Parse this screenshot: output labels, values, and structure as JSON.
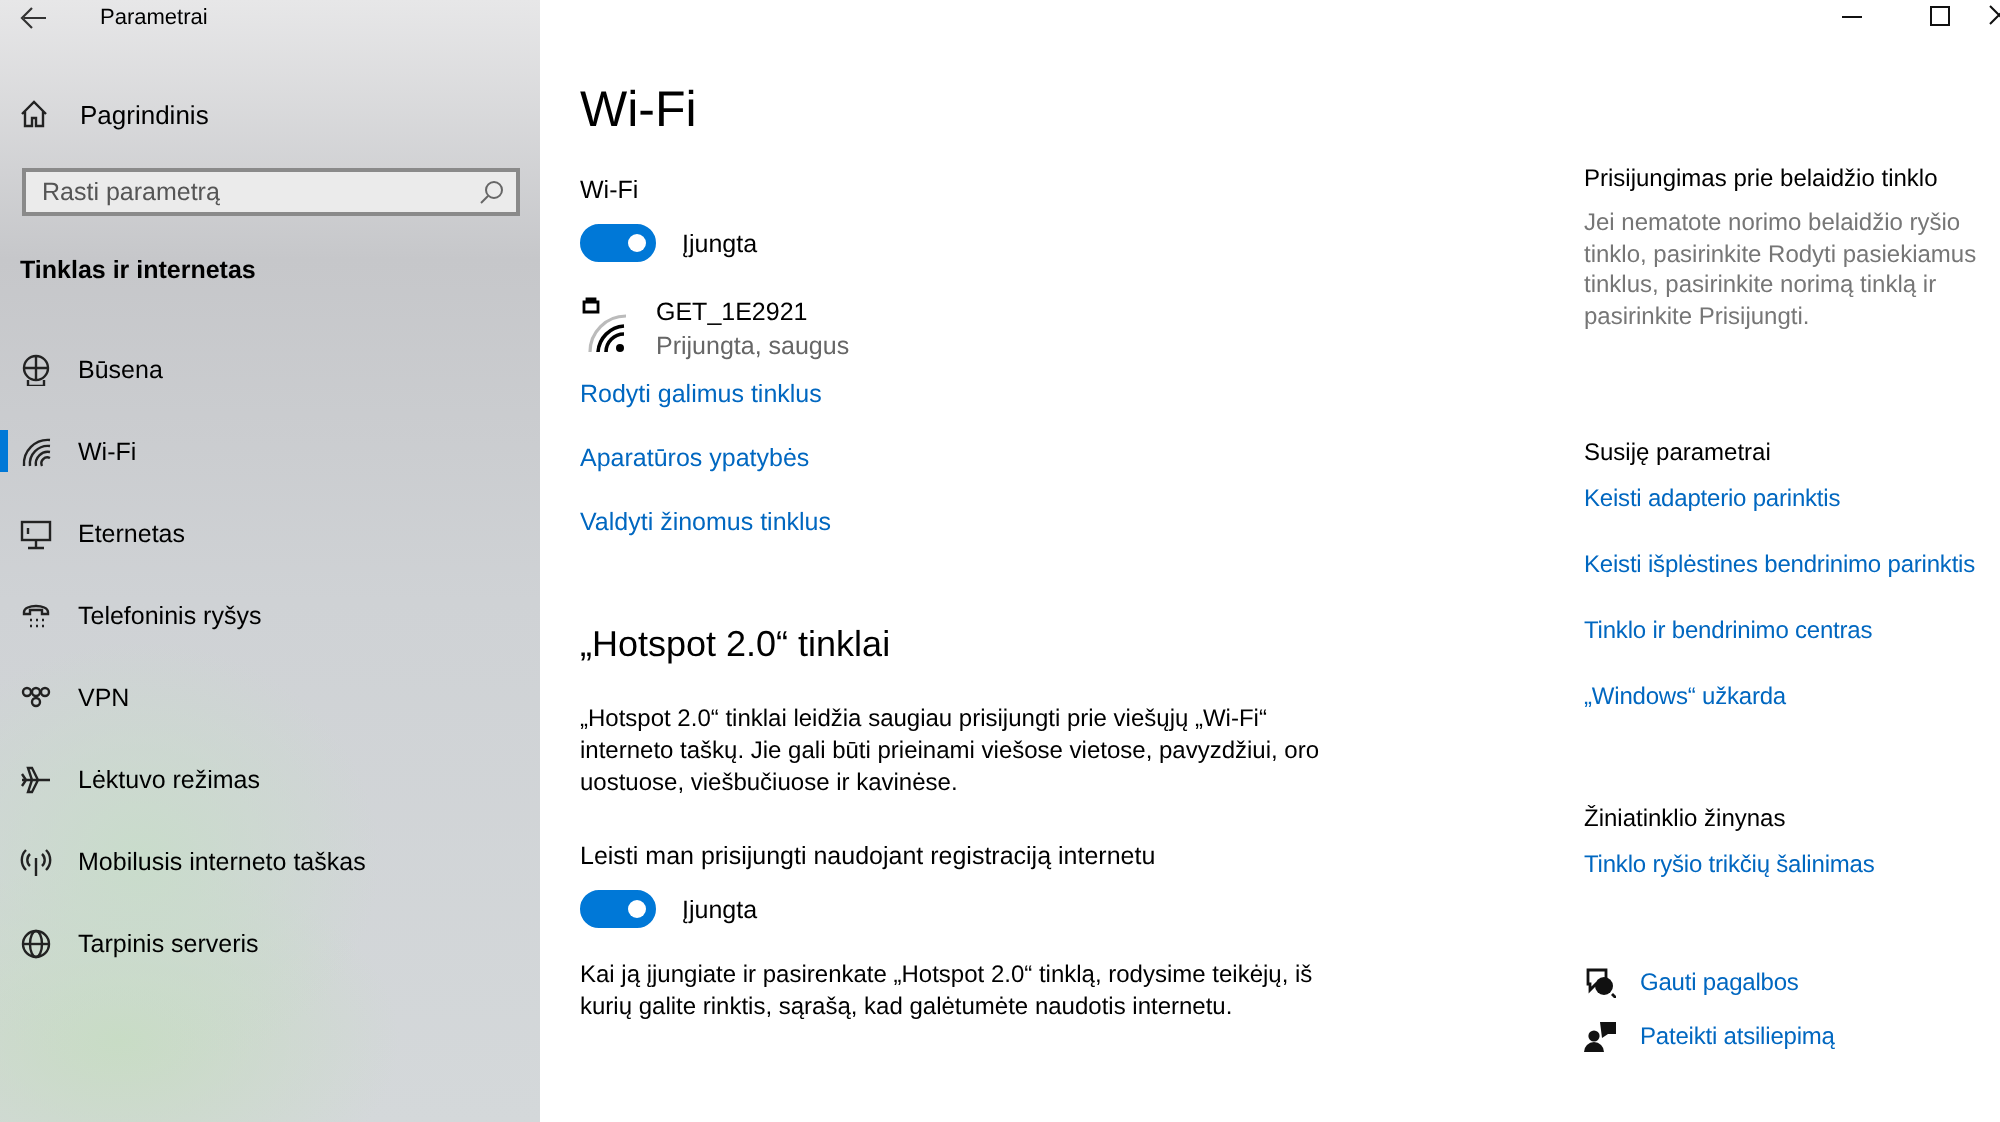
{
  "window": {
    "title": "Parametrai"
  },
  "sidebar": {
    "home": "Pagrindinis",
    "search": {
      "placeholder": "Rasti parametrą"
    },
    "section": "Tinklas ir internetas",
    "items": [
      {
        "label": "Būsena",
        "selected": false
      },
      {
        "label": "Wi-Fi",
        "selected": true
      },
      {
        "label": "Eternetas",
        "selected": false
      },
      {
        "label": "Telefoninis ryšys",
        "selected": false
      },
      {
        "label": "VPN",
        "selected": false
      },
      {
        "label": "Lėktuvo režimas",
        "selected": false
      },
      {
        "label": "Mobilusis interneto taškas",
        "selected": false
      },
      {
        "label": "Tarpinis serveris",
        "selected": false
      }
    ]
  },
  "main": {
    "title": "Wi-Fi",
    "wifi_toggle": {
      "label": "Wi-Fi",
      "on": true,
      "state_text": "Įjungta"
    },
    "network": {
      "name": "GET_1E2921",
      "status": "Prijungta, saugus"
    },
    "links": [
      "Rodyti galimus tinklus",
      "Aparatūros ypatybės",
      "Valdyti žinomus tinklus"
    ],
    "hotspot": {
      "heading": "„Hotspot 2.0“ tinklai",
      "description": "„Hotspot 2.0“ tinklai leidžia saugiau prisijungti prie viešųjų „Wi-Fi“ interneto taškų. Jie gali būti prieinami viešose vietose, pavyzdžiui, oro uostuose, viešbučiuose ir kavinėse.",
      "toggle": {
        "label": "Leisti man prisijungti naudojant registraciją internetu",
        "on": true,
        "state_text": "Įjungta"
      },
      "note": "Kai ją įjungiate ir pasirenkate „Hotspot 2.0“ tinklą, rodysime teikėjų, iš kurių galite rinktis, sąrašą, kad galėtumėte naudotis internetu."
    }
  },
  "related": {
    "sections": [
      {
        "heading": "Prisijungimas prie belaidžio tinklo",
        "text": "Jei nematote norimo belaidžio ryšio tinklo, pasirinkite Rodyti pasiekiamus tinklus, pasirinkite norimą tinklą ir pasirinkite Prisijungti."
      },
      {
        "heading": "Susiję parametrai",
        "links": [
          "Keisti adapterio parinktis",
          "Keisti išplėstines bendrinimo parinktis",
          "Tinklo ir bendrinimo centras",
          "„Windows“ užkarda"
        ]
      },
      {
        "heading": "Žiniatinklio žinynas",
        "links": [
          "Tinklo ryšio trikčių šalinimas"
        ]
      }
    ],
    "help_links": [
      "Gauti pagalbos",
      "Pateikti atsiliepimą"
    ]
  }
}
